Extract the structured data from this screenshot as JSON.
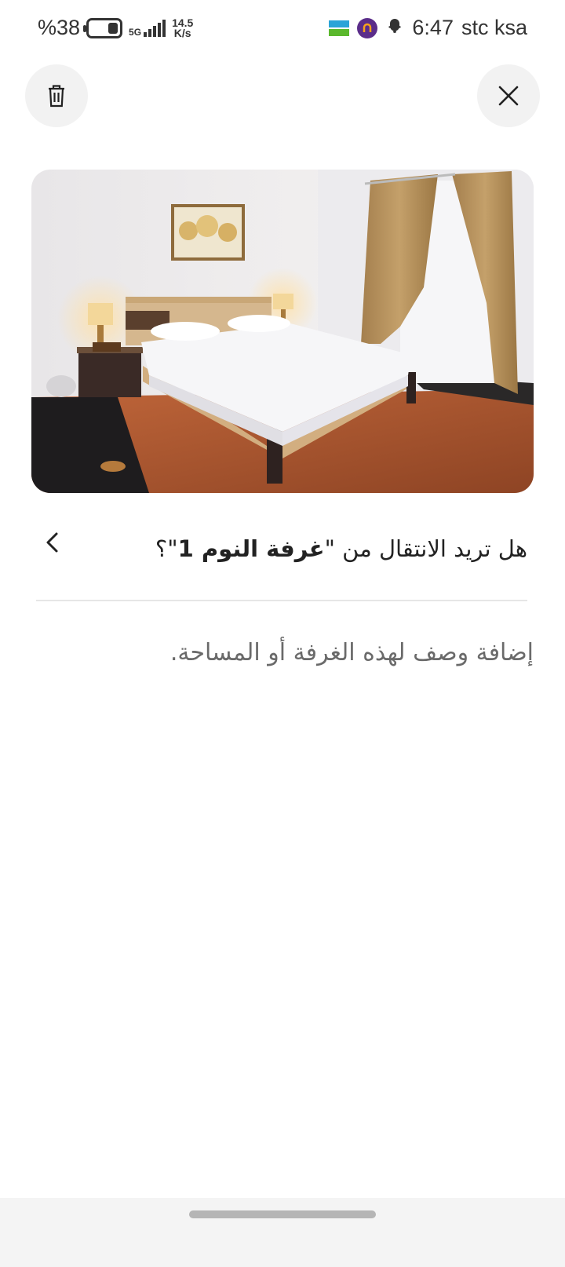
{
  "status_bar": {
    "battery": "%38",
    "network": "5G",
    "speed_value": "14.5",
    "speed_unit": "K/s",
    "time": "6:47",
    "carrier": "stc ksa"
  },
  "header": {
    "delete_icon": "trash-icon",
    "close_icon": "close-icon"
  },
  "photo": {
    "subject": "bedroom-photo"
  },
  "prompt": {
    "question_prefix": "هل تريد الانتقال من \"",
    "room_name": "غرفة النوم 1",
    "question_suffix": "\"؟",
    "back_icon": "chevron-left-icon"
  },
  "description": {
    "placeholder": "إضافة وصف لهذه الغرفة أو المساحة."
  },
  "colors": {
    "background": "#ffffff",
    "button_bg": "#f2f2f2",
    "text_primary": "#222222",
    "text_secondary": "#6a6a6a",
    "divider": "#e6e6e6"
  }
}
